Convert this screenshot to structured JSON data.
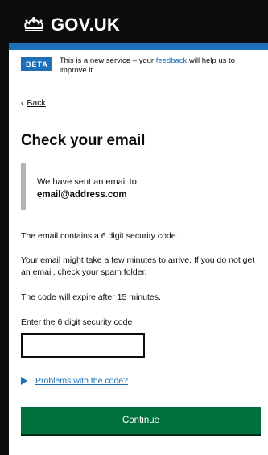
{
  "header": {
    "logo_text": "GOV.UK",
    "crown_icon": "crown-icon",
    "accent_color": "#1d70b8"
  },
  "phase_banner": {
    "tag": "BETA",
    "text_before": "This is a new service – your ",
    "link": "feedback",
    "text_after": " will help us to improve it."
  },
  "back_link": {
    "chevron_icon": "chevron-left-icon",
    "label": "Back"
  },
  "main": {
    "heading": "Check your email",
    "inset": {
      "line1": "We have sent an email to:",
      "email": "email@address.com"
    },
    "paragraphs": [
      "The email contains a 6 digit security code.",
      "Your email might take a few minutes to arrive. If you do not get an email, check your spam folder.",
      "The code will expire after 15 minutes."
    ],
    "code_input": {
      "label": "Enter the 6 digit security code",
      "value": ""
    },
    "details": {
      "arrow_icon": "triangle-right-icon",
      "summary": "Problems with the code?"
    },
    "continue_button": {
      "label": "Continue",
      "color": "#00703c"
    }
  }
}
